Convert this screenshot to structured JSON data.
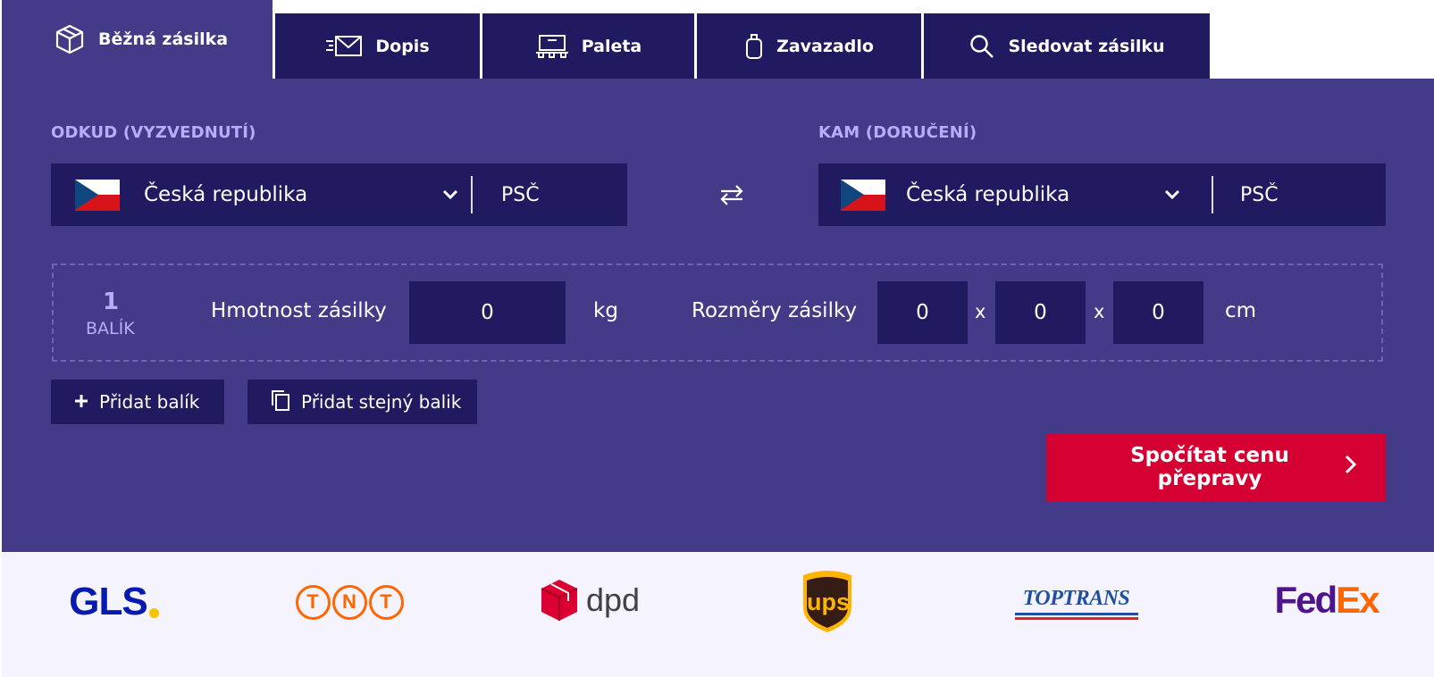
{
  "tabs": [
    {
      "label": "Běžná zásilka",
      "icon": "box-icon",
      "active": true
    },
    {
      "label": "Dopis",
      "icon": "envelope-icon"
    },
    {
      "label": "Paleta",
      "icon": "pallet-icon"
    },
    {
      "label": "Zavazadlo",
      "icon": "luggage-icon"
    },
    {
      "label": "Sledovat zásilku",
      "icon": "magnifier-icon"
    }
  ],
  "from": {
    "label": "ODKUD (VYZVEDNUTÍ)",
    "country": "Česká republika",
    "zip_placeholder": "PSČ"
  },
  "to": {
    "label": "KAM (DORUČENÍ)",
    "country": "Česká republika",
    "zip_placeholder": "PSČ"
  },
  "package": {
    "number": "1",
    "type": "BALÍK",
    "weight_label": "Hmotnost zásilky",
    "weight_value": "0",
    "weight_unit": "kg",
    "dims_label": "Rozměry zásilky",
    "length": "0",
    "width": "0",
    "height": "0",
    "times": "x",
    "dims_unit": "cm"
  },
  "actions": {
    "add_package": "Přidat balík",
    "add_same": "Přidat stejný balik",
    "calculate": "Spočítat cenu přepravy"
  },
  "carriers": [
    {
      "name": "GLS",
      "text": "GLS"
    },
    {
      "name": "TNT",
      "letters": [
        "T",
        "N",
        "T"
      ]
    },
    {
      "name": "DPD",
      "text": "dpd"
    },
    {
      "name": "UPS",
      "text": "ups"
    },
    {
      "name": "TOPTRANS",
      "text": "TOPTRANS"
    },
    {
      "name": "FedEx",
      "fed": "Fed",
      "ex": "Ex"
    }
  ],
  "colors": {
    "tab_bg": "#201a60",
    "panel_bg": "#433a88",
    "label": "#b7adff",
    "cta": "#d50032",
    "logos_bg": "#f5f3fd"
  }
}
